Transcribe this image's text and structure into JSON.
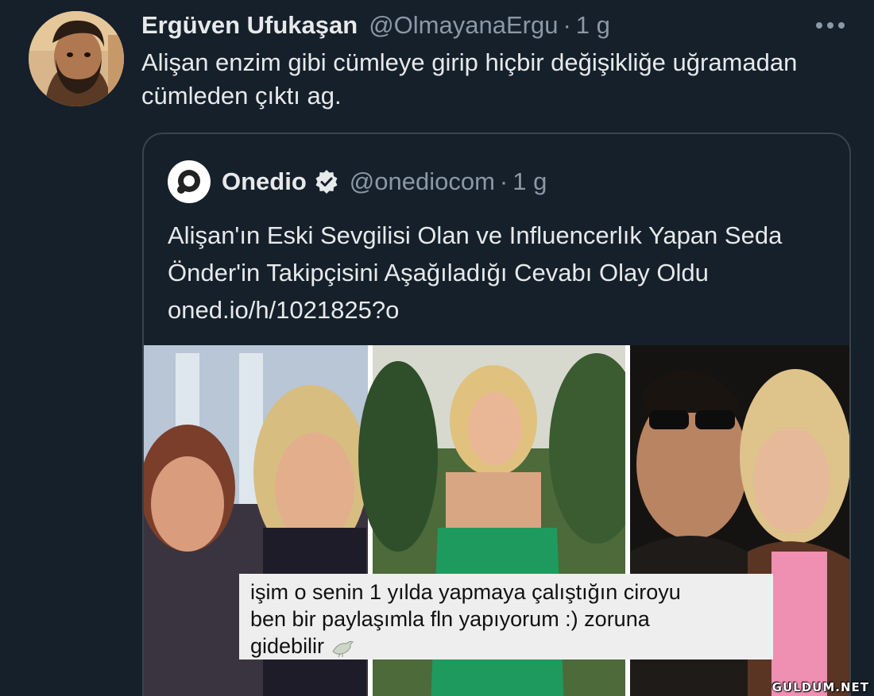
{
  "tweet": {
    "author": {
      "name": "Ergüven Ufukaşan",
      "handle": "@OlmayanaErgu",
      "avatar_icon": "profile-photo"
    },
    "separator": "·",
    "time": "1 g",
    "more_icon": "more-horizontal-icon",
    "text": "Alişan enzim gibi cümleye girip hiçbir değişikliğe uğramadan cümleden çıktı ag."
  },
  "quoted_tweet": {
    "author": {
      "name": "Onedio",
      "handle": "@onediocom",
      "verified": true,
      "logo_icon": "onedio-logo"
    },
    "separator": "·",
    "time": "1 g",
    "text": "Alişan'ın Eski Sevgilisi Olan ve Influencerlık Yapan Seda Önder'in Takipçisini Aşağıladığı Cevabı Olay Oldu oned.io/h/1021825?o",
    "media": {
      "caption_lines": [
        "işim o senin 1 yılda yapmaya çalıştığın ciroyu",
        "ben bir paylaşımla fln yapıyorum :) zoruna",
        "gidebilir"
      ],
      "caption_emoji": "dove-icon"
    }
  },
  "watermark": "GULDUM.NET",
  "colors": {
    "background": "#15202b",
    "text_primary": "#e7e9ea",
    "text_secondary": "#8b98a5",
    "border": "#38444d"
  }
}
